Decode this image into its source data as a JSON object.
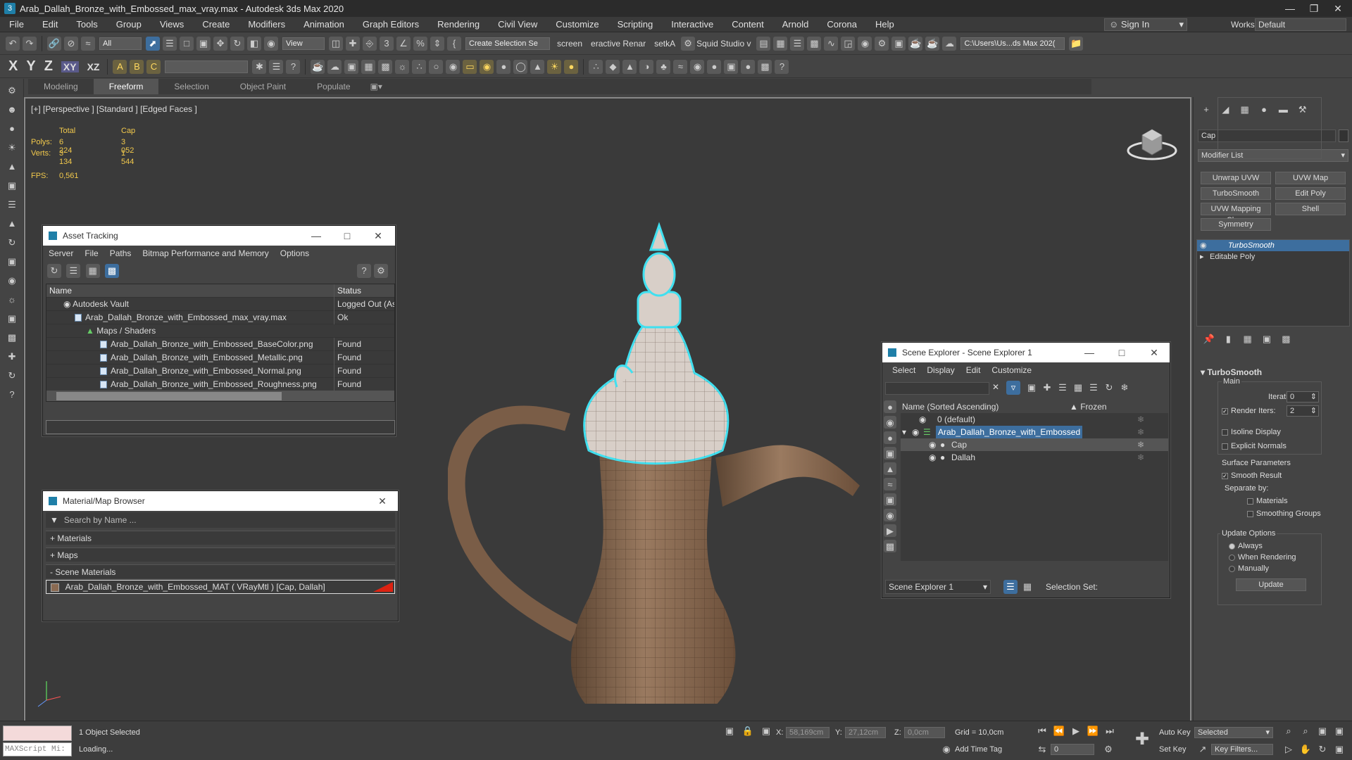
{
  "window": {
    "title": "Arab_Dallah_Bronze_with_Embossed_max_vray.max - Autodesk 3ds Max 2020",
    "logo": "3"
  },
  "menu": [
    "File",
    "Edit",
    "Tools",
    "Group",
    "Views",
    "Create",
    "Modifiers",
    "Animation",
    "Graph Editors",
    "Rendering",
    "Civil View",
    "Customize",
    "Scripting",
    "Interactive",
    "Content",
    "Arnold",
    "Corona",
    "Help"
  ],
  "signin": "Sign In",
  "workspace": {
    "label": "Workspaces:",
    "value": "Default"
  },
  "toolbar1": {
    "filter": "All",
    "ref_coord": "View",
    "selection_set": "Create Selection Se",
    "items": [
      "screen",
      "eractive Renar",
      "setkA",
      "Squid Studio v"
    ],
    "path": "C:\\Users\\Us...ds Max 202("
  },
  "toolbar2": {
    "axes": [
      "X",
      "Y",
      "Z",
      "XY",
      "XZ"
    ]
  },
  "ribbon": [
    "Modeling",
    "Freeform",
    "Selection",
    "Object Paint",
    "Populate"
  ],
  "viewport": {
    "label": "[+] [Perspective ] [Standard ] [Edged Faces ]",
    "stats": {
      "h_total": "Total",
      "h_cap": "Cap",
      "polys_label": "Polys:",
      "polys_total": "6 224",
      "polys_cap": "3 052",
      "verts_label": "Verts:",
      "verts_total": "3 134",
      "verts_cap": "1 544",
      "fps_label": "FPS:",
      "fps_value": "0,561"
    }
  },
  "asset_tracking": {
    "title": "Asset Tracking",
    "menu": [
      "Server",
      "File",
      "Paths",
      "Bitmap Performance and Memory",
      "Options"
    ],
    "col_name": "Name",
    "col_status": "Status",
    "rows": [
      {
        "name": "Autodesk Vault",
        "status": "Logged Out (As"
      },
      {
        "name": "Arab_Dallah_Bronze_with_Embossed_max_vray.max",
        "status": "Ok"
      },
      {
        "name": "Maps / Shaders",
        "status": ""
      },
      {
        "name": "Arab_Dallah_Bronze_with_Embossed_BaseColor.png",
        "status": "Found"
      },
      {
        "name": "Arab_Dallah_Bronze_with_Embossed_Metallic.png",
        "status": "Found"
      },
      {
        "name": "Arab_Dallah_Bronze_with_Embossed_Normal.png",
        "status": "Found"
      },
      {
        "name": "Arab_Dallah_Bronze_with_Embossed_Roughness.png",
        "status": "Found"
      }
    ]
  },
  "material_browser": {
    "title": "Material/Map Browser",
    "search_placeholder": "Search by Name ...",
    "materials": "+ Materials",
    "maps": "+ Maps",
    "scene_materials": "- Scene Materials",
    "item": "Arab_Dallah_Bronze_with_Embossed_MAT  ( VRayMtl ) [Cap, Dallah]"
  },
  "scene_explorer": {
    "title": "Scene Explorer - Scene Explorer 1",
    "menu": [
      "Select",
      "Display",
      "Edit",
      "Customize"
    ],
    "col_name": "Name (Sorted Ascending)",
    "col_frozen": "▲ Frozen",
    "rows": [
      {
        "name": "0 (default)"
      },
      {
        "name": "Arab_Dallah_Bronze_with_Embossed"
      },
      {
        "name": "Cap"
      },
      {
        "name": "Dallah"
      }
    ],
    "footer_select": "Scene Explorer 1",
    "selection_set": "Selection Set:"
  },
  "command_panel": {
    "object_name": "Cap",
    "modifier_list": "Modifier List",
    "buttons": [
      "Unwrap UVW",
      "UVW Map",
      "TurboSmooth",
      "Edit Poly",
      "UVW Mapping Clear",
      "Shell",
      "Symmetry"
    ],
    "stack": [
      "TurboSmooth",
      "Editable Poly"
    ],
    "rollout": "TurboSmooth",
    "main": "Main",
    "iterations_label": "Iterations:",
    "iterations_value": "0",
    "render_iters_label": "Render Iters:",
    "render_iters_value": "2",
    "isoline": "Isoline Display",
    "explicit": "Explicit Normals",
    "surface": "Surface Parameters",
    "smooth": "Smooth Result",
    "separate": "Separate by:",
    "sep_materials": "Materials",
    "sep_groups": "Smoothing Groups",
    "update_options": "Update Options",
    "always": "Always",
    "when_rendering": "When Rendering",
    "manually": "Manually",
    "update_btn": "Update"
  },
  "status": {
    "maxscript": "MAXScript Mi:",
    "selected": "1 Object Selected",
    "loading": "Loading...",
    "x_label": "X:",
    "x_value": "58,169cm",
    "y_label": "Y:",
    "y_value": "27,12cm",
    "z_label": "Z:",
    "z_value": "0,0cm",
    "grid": "Grid = 10,0cm",
    "add_time_tag": "Add Time Tag",
    "auto_key": "Auto Key",
    "set_key": "Set Key",
    "selected_drop": "Selected",
    "key_filters": "Key Filters...",
    "frame": "0"
  },
  "colors": {
    "accent": "#3d6e9e",
    "selection_cyan": "#40e0f0",
    "model": "#8a6a52",
    "stats": "#f2c94c"
  }
}
